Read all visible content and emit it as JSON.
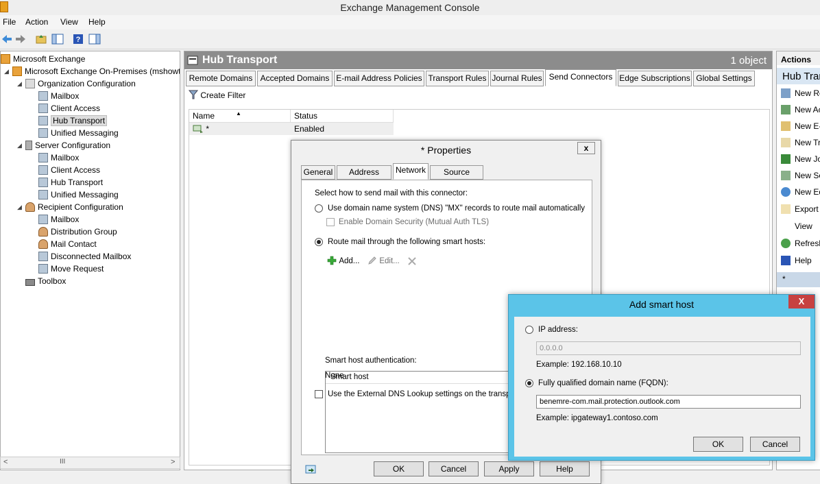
{
  "window": {
    "title": "Exchange Management Console"
  },
  "menu": {
    "items": [
      "File",
      "Action",
      "View",
      "Help"
    ]
  },
  "tree": {
    "root": "Microsoft Exchange",
    "onprem": "Microsoft Exchange On-Premises (mshowt",
    "org_config": "Organization Configuration",
    "org_children": [
      "Mailbox",
      "Client Access",
      "Hub Transport",
      "Unified Messaging"
    ],
    "server_config": "Server Configuration",
    "server_children": [
      "Mailbox",
      "Client Access",
      "Hub Transport",
      "Unified Messaging"
    ],
    "recipient_config": "Recipient Configuration",
    "recipient_children": [
      "Mailbox",
      "Distribution Group",
      "Mail Contact",
      "Disconnected Mailbox",
      "Move Request"
    ],
    "toolbox": "Toolbox",
    "scroll_left": "<",
    "scroll_thumb": "III",
    "scroll_right": ">"
  },
  "main": {
    "title": "Hub Transport",
    "count": "1 object",
    "tabs": [
      "Remote Domains",
      "Accepted Domains",
      "E-mail Address Policies",
      "Transport Rules",
      "Journal Rules",
      "Send Connectors",
      "Edge Subscriptions",
      "Global Settings"
    ],
    "active_tab": "Send Connectors",
    "create_filter": "Create Filter",
    "columns": [
      "Name",
      "Status"
    ],
    "rows": [
      {
        "name": "*",
        "status": "Enabled"
      }
    ]
  },
  "actions": {
    "header": "Actions",
    "section": "Hub Transport",
    "items": [
      "New Remote Domain...",
      "New Accepted Domain...",
      "New E-mail Address Policy...",
      "New Transport Rule...",
      "New Journal Rule...",
      "New Send Connector...",
      "New Edge Subscription...",
      "Export List...",
      "View",
      "Refresh",
      "Help"
    ],
    "section2": "*"
  },
  "properties": {
    "title": "* Properties",
    "close": "x",
    "tabs": [
      "General",
      "Address Space",
      "Network",
      "Source Server"
    ],
    "active_tab": "Network",
    "intro": "Select how to send mail with this connector:",
    "dns_option": "Use domain name system (DNS) \"MX\" records to route mail automatically",
    "domain_security": "Enable Domain Security (Mutual Auth TLS)",
    "smarthost_option": "Route mail through the following smart hosts:",
    "add": "Add...",
    "edit": "Edit...",
    "list_header": "Smart host",
    "auth_label": "Smart host authentication:",
    "auth_value": "None",
    "external_dns": "Use the External DNS Lookup settings on the transport s",
    "buttons": {
      "ok": "OK",
      "cancel": "Cancel",
      "apply": "Apply",
      "help": "Help"
    }
  },
  "add_smart_host": {
    "title": "Add smart host",
    "close": "X",
    "ip_label": "IP address:",
    "ip_value": "0.0.0.0",
    "ip_example": "Example: 192.168.10.10",
    "fqdn_label": "Fully qualified domain name (FQDN):",
    "fqdn_value": "benemre-com.mail.protection.outlook.com",
    "fqdn_example": "Example: ipgateway1.contoso.com",
    "ok": "OK",
    "cancel": "Cancel"
  }
}
